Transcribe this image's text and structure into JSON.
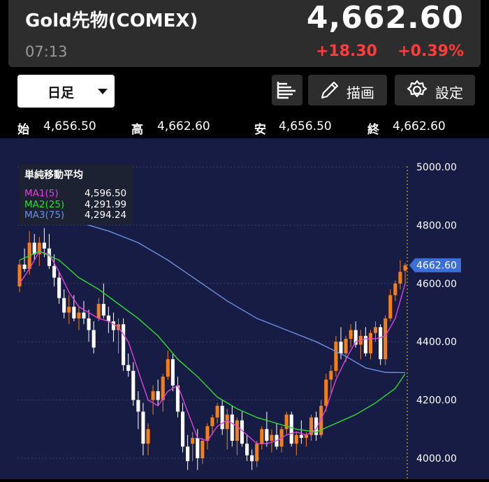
{
  "header": {
    "title": "Gold先物(COMEX)",
    "price": "4,662.60",
    "time": "07:13",
    "change": "+18.30",
    "change_pct": "+0.39%"
  },
  "toolbar": {
    "period": "日足",
    "draw_label": "描画",
    "settings_label": "設定"
  },
  "ohlc": {
    "open_label": "始",
    "open": "4,656.50",
    "high_label": "高",
    "high": "4,662.60",
    "low_label": "安",
    "low": "4,656.50",
    "close_label": "終",
    "close": "4,662.60"
  },
  "legend": {
    "title": "単純移動平均",
    "items": [
      {
        "name": "MA1(5)",
        "value": "4,596.50",
        "color": "#e040e0"
      },
      {
        "name": "MA2(25)",
        "value": "4,291.99",
        "color": "#2edb2e"
      },
      {
        "name": "MA3(75)",
        "value": "4,294.24",
        "color": "#6b8fe0"
      }
    ]
  },
  "colors": {
    "up": "#f57f17",
    "down": "#ffffff",
    "background": "#171c45",
    "price_tag": "#3b6fd6",
    "change": "#ff3b3b"
  },
  "chart_data": {
    "type": "candlestick",
    "y_ticks": [
      "5000.00",
      "4800.00",
      "4600.00",
      "4400.00",
      "4200.00",
      "4000.00"
    ],
    "ylim": [
      3965,
      5075
    ],
    "last_price_label": "4662.60",
    "candles": [
      [
        4590,
        4680,
        4570,
        4665
      ],
      [
        4665,
        4720,
        4640,
        4650
      ],
      [
        4650,
        4780,
        4630,
        4740
      ],
      [
        4740,
        4770,
        4680,
        4700
      ],
      [
        4700,
        4760,
        4660,
        4740
      ],
      [
        4740,
        4790,
        4690,
        4720
      ],
      [
        4720,
        4770,
        4650,
        4660
      ],
      [
        4660,
        4700,
        4590,
        4620
      ],
      [
        4620,
        4640,
        4530,
        4550
      ],
      [
        4550,
        4580,
        4480,
        4500
      ],
      [
        4500,
        4560,
        4460,
        4520
      ],
      [
        4520,
        4560,
        4470,
        4480
      ],
      [
        4480,
        4520,
        4440,
        4500
      ],
      [
        4500,
        4540,
        4460,
        4480
      ],
      [
        4480,
        4510,
        4400,
        4440
      ],
      [
        4440,
        4470,
        4360,
        4380
      ],
      [
        4480,
        4550,
        4470,
        4530
      ],
      [
        4530,
        4600,
        4480,
        4490
      ],
      [
        4490,
        4520,
        4430,
        4470
      ],
      [
        4470,
        4500,
        4400,
        4440
      ],
      [
        4440,
        4480,
        4360,
        4460
      ],
      [
        4460,
        4480,
        4300,
        4320
      ],
      [
        4320,
        4360,
        4280,
        4300
      ],
      [
        4300,
        4330,
        4180,
        4200
      ],
      [
        4200,
        4230,
        4100,
        4160
      ],
      [
        4160,
        4190,
        4010,
        4050
      ],
      [
        4050,
        4120,
        4010,
        4100
      ],
      [
        4200,
        4250,
        4150,
        4230
      ],
      [
        4230,
        4270,
        4180,
        4200
      ],
      [
        4200,
        4290,
        4160,
        4280
      ],
      [
        4280,
        4370,
        4270,
        4340
      ],
      [
        4340,
        4360,
        4230,
        4250
      ],
      [
        4250,
        4280,
        4140,
        4160
      ],
      [
        4160,
        4190,
        4020,
        4040
      ],
      [
        4040,
        4080,
        3960,
        3990
      ],
      [
        4050,
        4090,
        3990,
        4070
      ],
      [
        4070,
        4100,
        3960,
        4000
      ],
      [
        4000,
        4070,
        3980,
        4060
      ],
      [
        4060,
        4120,
        4030,
        4110
      ],
      [
        4110,
        4150,
        4080,
        4140
      ],
      [
        4140,
        4190,
        4120,
        4180
      ],
      [
        4180,
        4200,
        4080,
        4100
      ],
      [
        4100,
        4170,
        4030,
        4150
      ],
      [
        4150,
        4180,
        4040,
        4060
      ],
      [
        4060,
        4140,
        4010,
        4130
      ],
      [
        4130,
        4160,
        4040,
        4050
      ],
      [
        4050,
        4080,
        3990,
        4010
      ],
      [
        4010,
        4030,
        3960,
        3990
      ],
      [
        3990,
        4060,
        3970,
        4050
      ],
      [
        4050,
        4110,
        4030,
        4100
      ],
      [
        4100,
        4160,
        4040,
        4060
      ],
      [
        4060,
        4100,
        4020,
        4080
      ],
      [
        4080,
        4120,
        4030,
        4040
      ],
      [
        4040,
        4110,
        4020,
        4100
      ],
      [
        4100,
        4160,
        4080,
        4150
      ],
      [
        4150,
        4160,
        4040,
        4050
      ],
      [
        4050,
        4090,
        4010,
        4080
      ],
      [
        4080,
        4130,
        4050,
        4070
      ],
      [
        4070,
        4090,
        4040,
        4080
      ],
      [
        4080,
        4150,
        4060,
        4140
      ],
      [
        4140,
        4160,
        4060,
        4080
      ],
      [
        4080,
        4200,
        4070,
        4180
      ],
      [
        4180,
        4290,
        4160,
        4270
      ],
      [
        4270,
        4320,
        4220,
        4300
      ],
      [
        4300,
        4420,
        4280,
        4400
      ],
      [
        4400,
        4450,
        4340,
        4360
      ],
      [
        4360,
        4420,
        4330,
        4410
      ],
      [
        4410,
        4460,
        4380,
        4440
      ],
      [
        4440,
        4470,
        4380,
        4390
      ],
      [
        4390,
        4440,
        4340,
        4420
      ],
      [
        4420,
        4450,
        4350,
        4360
      ],
      [
        4360,
        4440,
        4340,
        4430
      ],
      [
        4430,
        4470,
        4400,
        4450
      ],
      [
        4450,
        4460,
        4320,
        4340
      ],
      [
        4340,
        4490,
        4320,
        4480
      ],
      [
        4480,
        4580,
        4470,
        4560
      ],
      [
        4560,
        4610,
        4540,
        4600
      ],
      [
        4600,
        4680,
        4580,
        4640
      ],
      [
        4644,
        4670,
        4600,
        4662.6
      ]
    ],
    "ma_lines": [
      {
        "name": "MA1(5)",
        "color": "#e040e0",
        "points": [
          [
            0,
            4600
          ],
          [
            2,
            4650
          ],
          [
            4,
            4710
          ],
          [
            6,
            4700
          ],
          [
            8,
            4640
          ],
          [
            10,
            4570
          ],
          [
            12,
            4520
          ],
          [
            14,
            4500
          ],
          [
            16,
            4480
          ],
          [
            18,
            4470
          ],
          [
            20,
            4450
          ],
          [
            22,
            4400
          ],
          [
            24,
            4300
          ],
          [
            26,
            4200
          ],
          [
            28,
            4180
          ],
          [
            30,
            4230
          ],
          [
            32,
            4250
          ],
          [
            34,
            4160
          ],
          [
            36,
            4070
          ],
          [
            38,
            4060
          ],
          [
            40,
            4110
          ],
          [
            42,
            4130
          ],
          [
            44,
            4110
          ],
          [
            46,
            4080
          ],
          [
            48,
            4050
          ],
          [
            50,
            4050
          ],
          [
            52,
            4060
          ],
          [
            54,
            4080
          ],
          [
            56,
            4090
          ],
          [
            58,
            4080
          ],
          [
            60,
            4100
          ],
          [
            62,
            4170
          ],
          [
            64,
            4270
          ],
          [
            66,
            4340
          ],
          [
            68,
            4400
          ],
          [
            70,
            4410
          ],
          [
            72,
            4410
          ],
          [
            74,
            4420
          ],
          [
            76,
            4480
          ],
          [
            78,
            4600
          ]
        ]
      },
      {
        "name": "MA2(25)",
        "color": "#2edb2e",
        "points": [
          [
            0,
            4680
          ],
          [
            4,
            4710
          ],
          [
            8,
            4680
          ],
          [
            12,
            4620
          ],
          [
            16,
            4580
          ],
          [
            20,
            4530
          ],
          [
            24,
            4480
          ],
          [
            28,
            4420
          ],
          [
            32,
            4340
          ],
          [
            36,
            4280
          ],
          [
            40,
            4210
          ],
          [
            44,
            4170
          ],
          [
            48,
            4140
          ],
          [
            52,
            4120
          ],
          [
            56,
            4100
          ],
          [
            60,
            4090
          ],
          [
            64,
            4120
          ],
          [
            68,
            4150
          ],
          [
            72,
            4190
          ],
          [
            76,
            4240
          ],
          [
            78,
            4290
          ]
        ]
      },
      {
        "name": "MA3(75)",
        "color": "#6b8fe0",
        "points": [
          [
            0,
            4840
          ],
          [
            6,
            4840
          ],
          [
            12,
            4810
          ],
          [
            18,
            4780
          ],
          [
            24,
            4740
          ],
          [
            30,
            4680
          ],
          [
            36,
            4610
          ],
          [
            42,
            4540
          ],
          [
            48,
            4480
          ],
          [
            54,
            4440
          ],
          [
            60,
            4400
          ],
          [
            66,
            4350
          ],
          [
            70,
            4310
          ],
          [
            74,
            4295
          ],
          [
            78,
            4294
          ]
        ]
      }
    ]
  }
}
